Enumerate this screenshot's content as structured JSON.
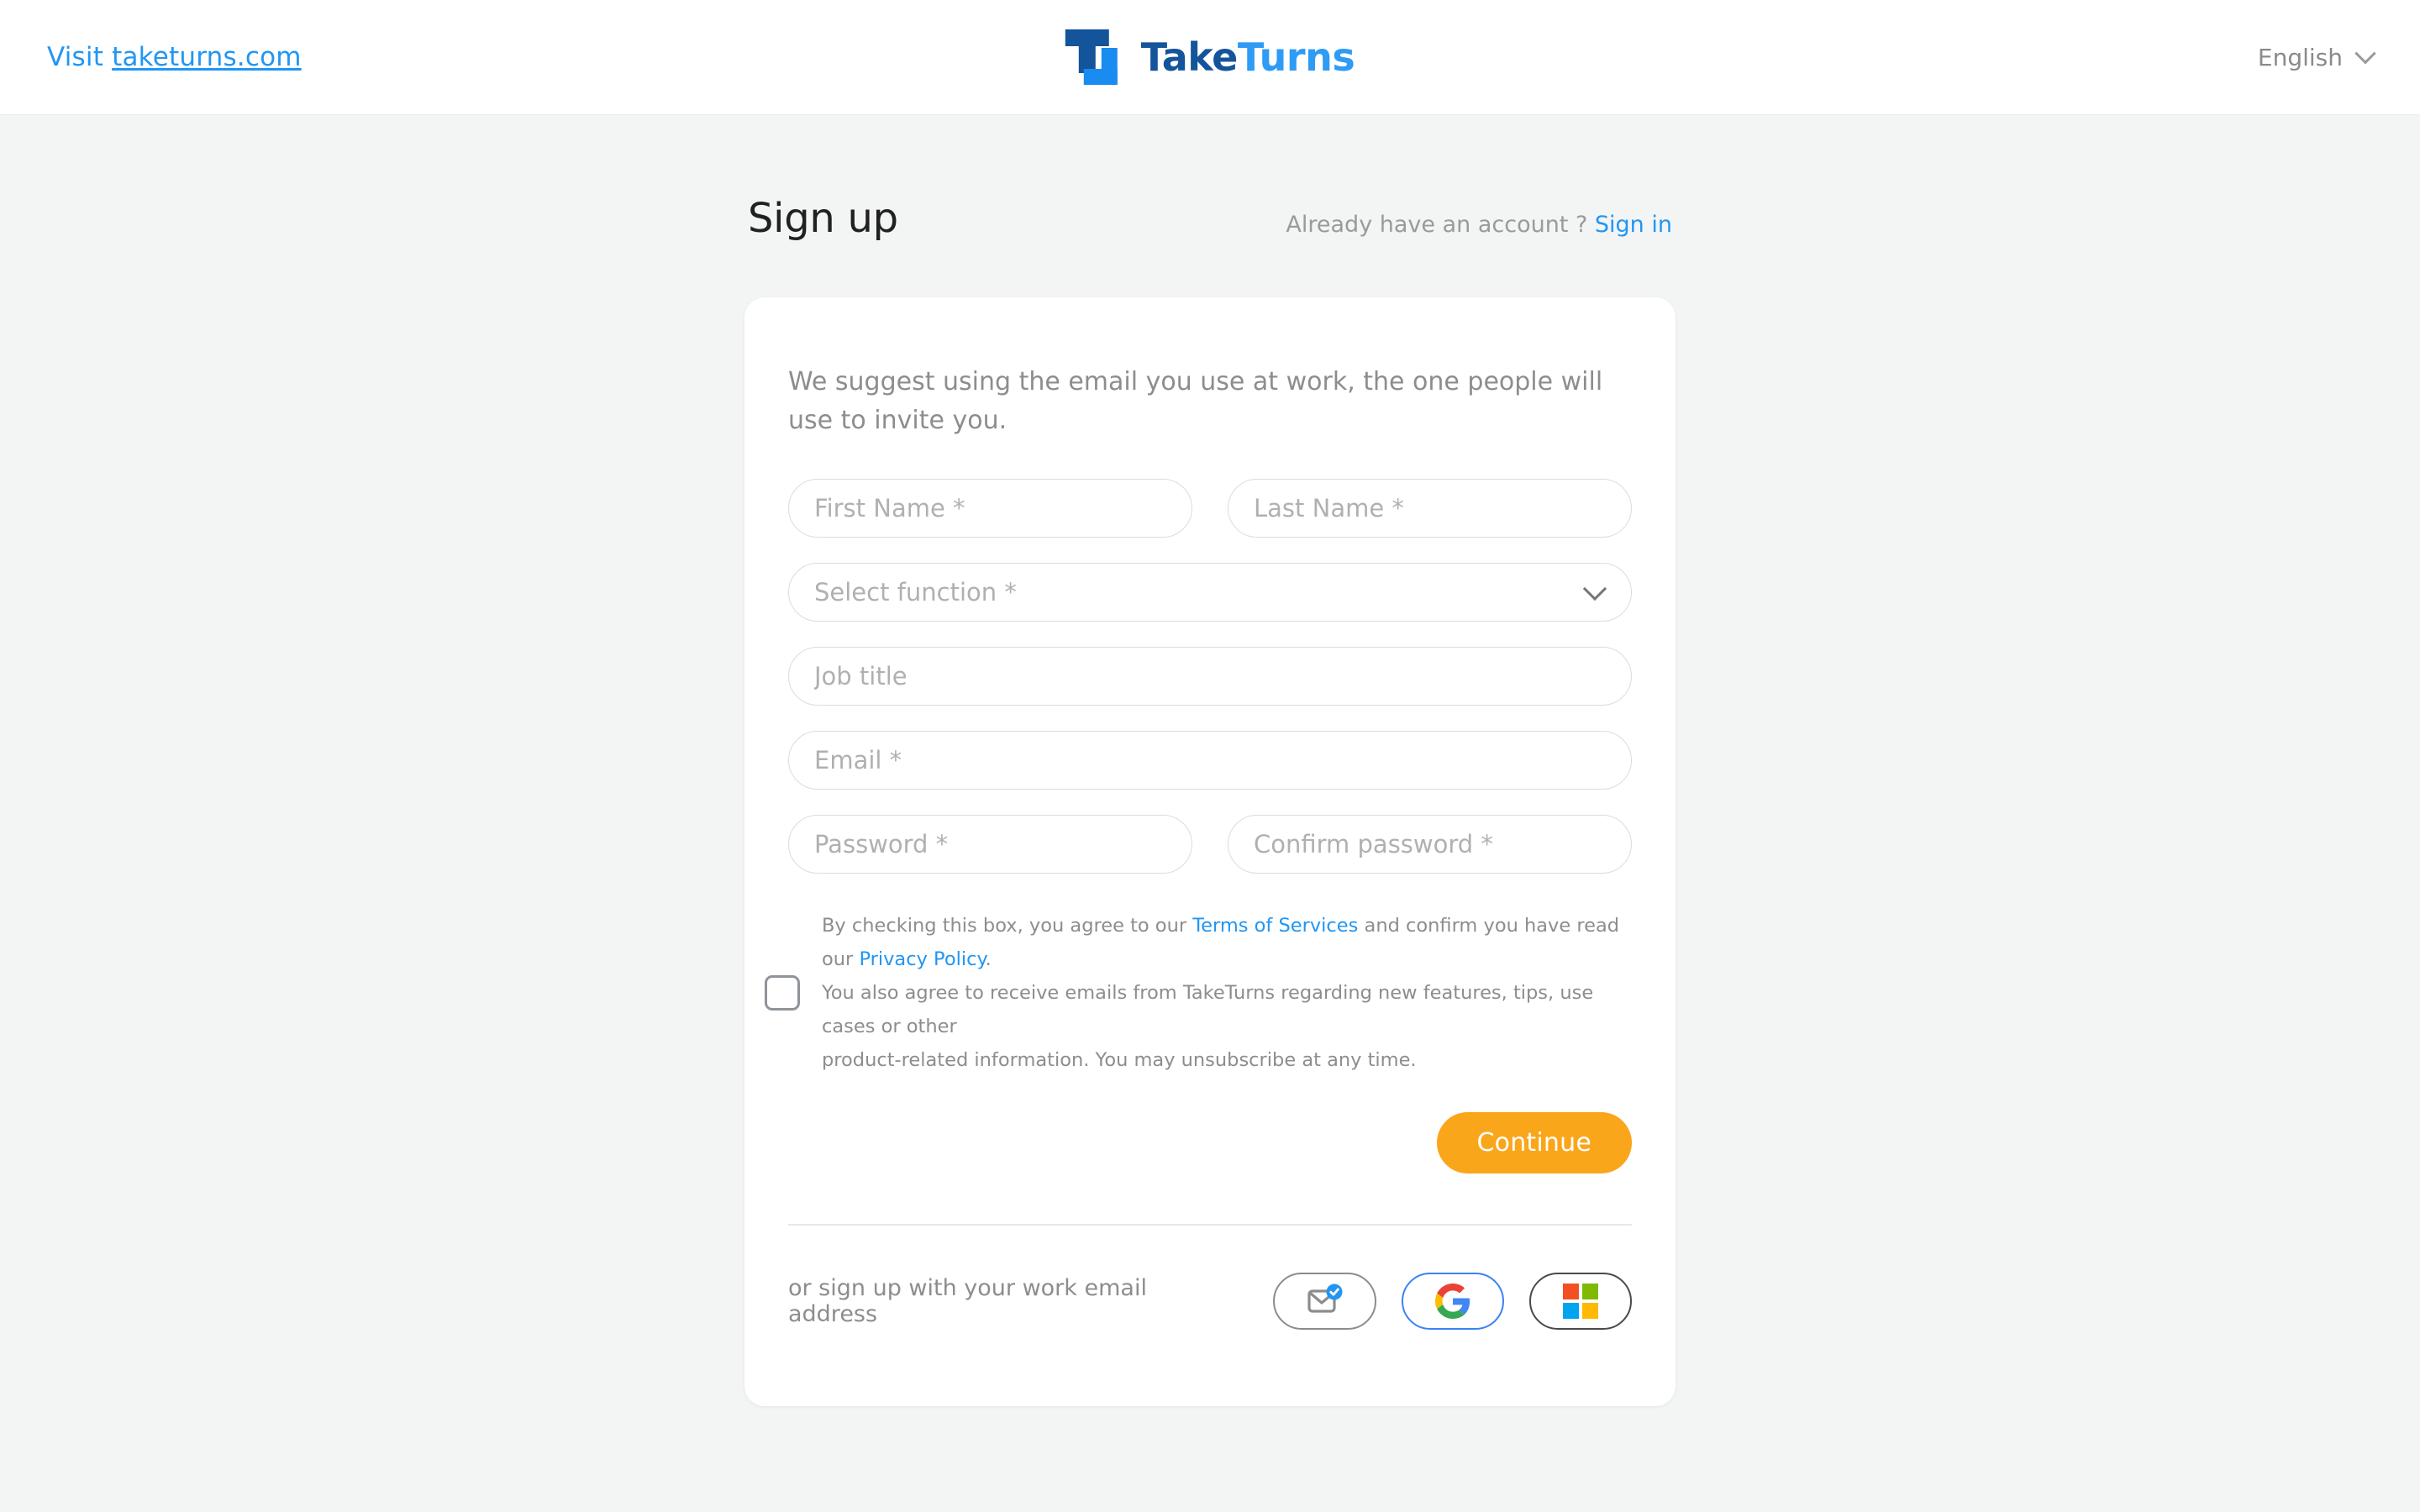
{
  "header": {
    "visit_label": "Visit ",
    "visit_link": "taketurns.com",
    "logo_text_1": "Take",
    "logo_text_2": "Turns",
    "language": "English",
    "chevron_icon": "chevron-down-icon"
  },
  "page": {
    "title": "Sign up",
    "account_prompt": "Already have an account ?",
    "sign_in_link": "Sign in"
  },
  "form": {
    "lead": "We suggest using the email you use at work, the one people will use to invite you.",
    "first_name_placeholder": "First Name *",
    "last_name_placeholder": "Last Name *",
    "function_placeholder": "Select function *",
    "job_title_placeholder": "Job title",
    "email_placeholder": "Email *",
    "password_placeholder": "Password *",
    "confirm_password_placeholder": "Confirm password *",
    "consent": {
      "line1_a": "By checking this box, you agree to our ",
      "terms_link": "Terms of Services",
      "line1_b": " and confirm you have read our ",
      "privacy_link": "Privacy Policy",
      "line1_c": ".",
      "line2": "You also agree to receive emails from TakeTurns regarding new features, tips, use cases or other",
      "line3": "product-related information. You may unsubscribe at any time.",
      "checked": false
    },
    "continue_label": "Continue"
  },
  "social": {
    "label": "or sign up with your work email address",
    "buttons": [
      {
        "name": "email-verified-icon",
        "title": "Email"
      },
      {
        "name": "google-icon",
        "title": "Google"
      },
      {
        "name": "microsoft-icon",
        "title": "Microsoft"
      }
    ]
  },
  "colors": {
    "accent_orange": "#faa61a",
    "link_blue": "#2196f3",
    "logo_dark_blue": "#14549b",
    "logo_light_blue": "#2e9bf5",
    "page_bg": "#f3f4f4",
    "card_bg": "#ffffff",
    "placeholder": "#b0b0b0",
    "muted_text": "#8d8d8d",
    "ms_red": "#f25022",
    "ms_green": "#7fba00",
    "ms_blue": "#00a4ef",
    "ms_yellow": "#ffb900"
  }
}
